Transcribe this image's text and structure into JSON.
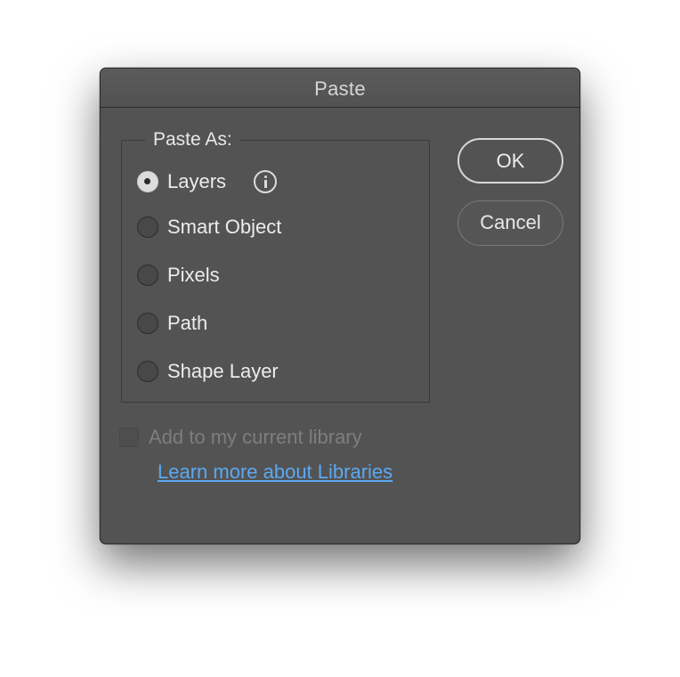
{
  "dialog": {
    "title": "Paste",
    "group_label": "Paste As:",
    "options": [
      {
        "label": "Layers",
        "selected": true
      },
      {
        "label": "Smart Object",
        "selected": false
      },
      {
        "label": "Pixels",
        "selected": false
      },
      {
        "label": "Path",
        "selected": false
      },
      {
        "label": "Shape Layer",
        "selected": false
      }
    ],
    "info_icon": "info-icon",
    "ok_label": "OK",
    "cancel_label": "Cancel",
    "library_checkbox": {
      "label": "Add to my current library",
      "checked": false,
      "enabled": false
    },
    "learn_more_link": "Learn more about Libraries"
  },
  "colors": {
    "dialog_bg": "#535353",
    "link": "#5aa9f3",
    "text": "#ececec",
    "disabled_text": "#7e7e7e"
  }
}
